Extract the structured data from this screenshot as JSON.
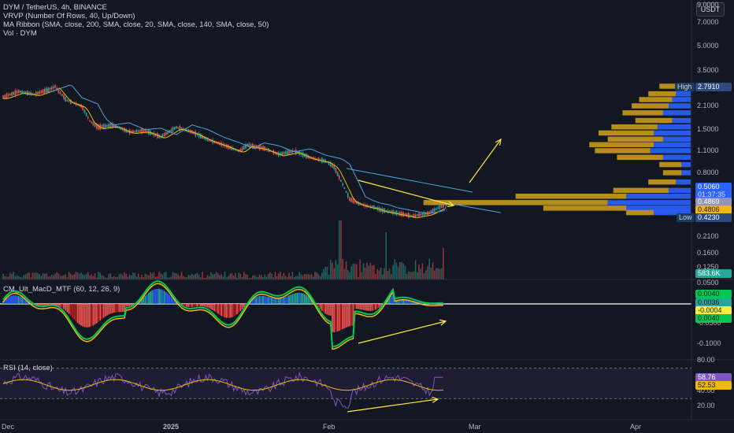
{
  "header": {
    "symbol_line": "DYM / TetherUS, 4h, BINANCE",
    "indicator_1": "VRVP (Number Of Rows, 40, Up/Down)",
    "indicator_2": "MA Ribbon (SMA, close, 200, SMA, close, 20, SMA, close, 140, SMA, close, 50)",
    "indicator_3": "Vol · DYM",
    "currency_button": "USDT"
  },
  "macd_label": "CM_Ult_MacD_MTF (60, 12, 26, 9)",
  "rsi_label": "RSI (14, close)",
  "colors": {
    "background": "#131722",
    "up": "#26a69a",
    "down": "#ef5350",
    "ma_fast": "#f0b90b",
    "ma_slow": "#4aa3df",
    "arrow": "#ffeb3b",
    "vp_up": "#2962ff",
    "vp_down": "#c99a1b",
    "rsi_line": "#7e57c2"
  },
  "price_tags": {
    "high_label": "High",
    "high_value": "2.7910",
    "low_label": "Low",
    "low_value": "0.4230",
    "last_price": "0.5060",
    "countdown": "01:37:35",
    "tag_2": "0.4869",
    "tag_3": "0.4806",
    "volume": "583.6K"
  },
  "macd_tags": {
    "t1": "0.0040",
    "t2": "0.0036",
    "t3": "-0.0004",
    "t4": "0.0040"
  },
  "rsi_tags": {
    "t1": "58.76",
    "t2": "52.53"
  },
  "chart_data": {
    "type": "line",
    "title": "DYM / TetherUS, 4h, BINANCE",
    "xlabel": "",
    "ylabel": "",
    "x_ticks": [
      "Dec",
      "2025",
      "Feb",
      "Mar",
      "Apr"
    ],
    "price_axis_log": true,
    "price_ticks": [
      "9.0000",
      "7.0000",
      "5.0000",
      "3.5000",
      "2.1000",
      "1.5000",
      "1.1000",
      "0.8000",
      "0.6000"
    ],
    "volume_ticks": [
      "0.2100",
      "0.1600",
      "0.1250"
    ],
    "macd_ticks": [
      "0.0500",
      "-0.0500",
      "-0.1000"
    ],
    "rsi_ticks": [
      "80.00",
      "40.00",
      "20.00"
    ],
    "price_series": {
      "name": "DYM/USDT close (approx.)",
      "x_index": [
        0,
        20,
        40,
        60,
        66,
        80,
        100,
        110,
        120,
        140,
        160,
        180,
        200,
        220,
        240,
        260,
        280,
        300,
        310,
        330,
        350,
        370,
        390,
        410,
        420,
        430,
        440,
        450,
        460,
        470,
        480,
        490,
        500,
        520,
        540,
        560
      ],
      "values": [
        2.4,
        2.6,
        2.5,
        2.7,
        2.79,
        2.3,
        2.1,
        1.7,
        1.55,
        1.6,
        1.45,
        1.48,
        1.35,
        1.55,
        1.45,
        1.3,
        1.2,
        1.1,
        1.2,
        1.15,
        1.05,
        1.1,
        1.0,
        0.95,
        0.88,
        0.7,
        0.55,
        0.52,
        0.5,
        0.49,
        0.47,
        0.46,
        0.45,
        0.43,
        0.45,
        0.506
      ]
    },
    "volume_profile": [
      {
        "price": 2.79,
        "up": 0.05,
        "down": 0.12
      },
      {
        "price": 2.5,
        "up": 0.08,
        "down": 0.15
      },
      {
        "price": 2.3,
        "up": 0.1,
        "down": 0.18
      },
      {
        "price": 2.1,
        "up": 0.12,
        "down": 0.2
      },
      {
        "price": 1.9,
        "up": 0.15,
        "down": 0.22
      },
      {
        "price": 1.7,
        "up": 0.1,
        "down": 0.2
      },
      {
        "price": 1.55,
        "up": 0.18,
        "down": 0.25
      },
      {
        "price": 1.42,
        "up": 0.2,
        "down": 0.3
      },
      {
        "price": 1.3,
        "up": 0.15,
        "down": 0.3
      },
      {
        "price": 1.2,
        "up": 0.2,
        "down": 0.35
      },
      {
        "price": 1.1,
        "up": 0.22,
        "down": 0.3
      },
      {
        "price": 1.0,
        "up": 0.15,
        "down": 0.25
      },
      {
        "price": 0.9,
        "up": 0.05,
        "down": 0.12
      },
      {
        "price": 0.8,
        "up": 0.05,
        "down": 0.1
      },
      {
        "price": 0.7,
        "up": 0.08,
        "down": 0.15
      },
      {
        "price": 0.62,
        "up": 0.12,
        "down": 0.3
      },
      {
        "price": 0.57,
        "up": 0.35,
        "down": 0.6
      },
      {
        "price": 0.52,
        "up": 0.45,
        "down": 1.0
      },
      {
        "price": 0.48,
        "up": 0.35,
        "down": 0.45
      },
      {
        "price": 0.45,
        "up": 0.2,
        "down": 0.15
      }
    ],
    "rsi": {
      "last": 58.76,
      "signal": 52.53,
      "range": [
        20,
        80
      ]
    },
    "macd": {
      "last": -0.0004,
      "signal": 0.004
    }
  }
}
